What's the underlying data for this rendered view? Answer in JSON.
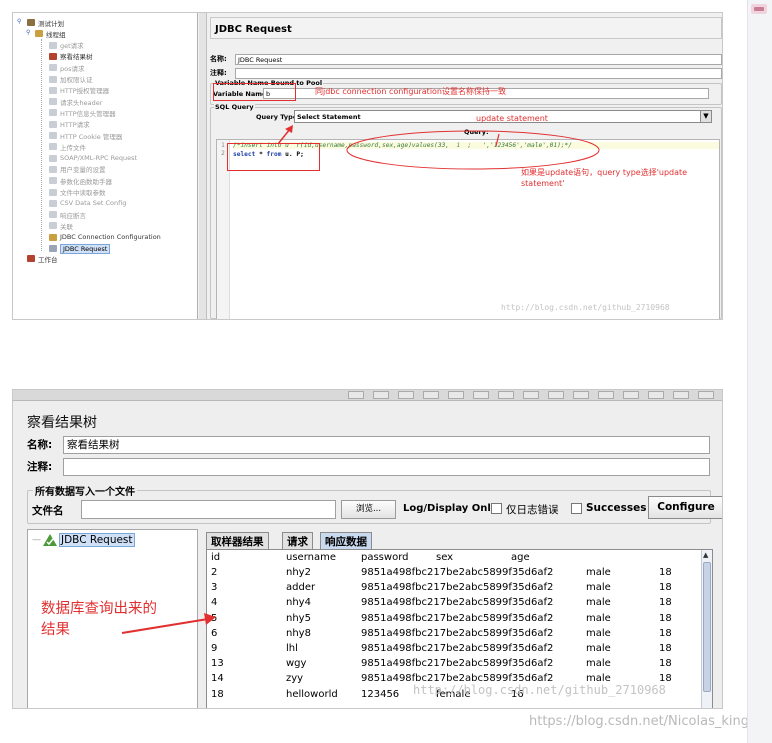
{
  "top": {
    "tree": {
      "items": [
        {
          "label": "测试计划",
          "level": 0,
          "dim": false
        },
        {
          "label": "线程组",
          "level": 1,
          "dim": false
        },
        {
          "label": "get请求",
          "level": 2,
          "dim": true
        },
        {
          "label": "察看结果树",
          "level": 2,
          "dim": false
        },
        {
          "label": "pos请求",
          "level": 2,
          "dim": true
        },
        {
          "label": "加权限认证",
          "level": 2,
          "dim": true
        },
        {
          "label": "HTTP授权管理器",
          "level": 2,
          "dim": true
        },
        {
          "label": "请求头header",
          "level": 2,
          "dim": true
        },
        {
          "label": "HTTP信息头管理器",
          "level": 2,
          "dim": true
        },
        {
          "label": "HTTP请求",
          "level": 2,
          "dim": true
        },
        {
          "label": "HTTP Cookie 管理器",
          "level": 2,
          "dim": true
        },
        {
          "label": "上传文件",
          "level": 2,
          "dim": true
        },
        {
          "label": "SOAP/XML-RPC Request",
          "level": 2,
          "dim": true
        },
        {
          "label": "用户变量的设置",
          "level": 2,
          "dim": true
        },
        {
          "label": "参数化函数助手器",
          "level": 2,
          "dim": true
        },
        {
          "label": "文件中读取参数",
          "level": 2,
          "dim": true
        },
        {
          "label": "CSV Data Set Config",
          "level": 2,
          "dim": true
        },
        {
          "label": "响应断言",
          "level": 2,
          "dim": true
        },
        {
          "label": "关联",
          "level": 2,
          "dim": true
        },
        {
          "label": "JDBC Connection Configuration",
          "level": 2,
          "dim": false
        },
        {
          "label": "JDBC Request",
          "level": 2,
          "dim": false,
          "selected": true
        },
        {
          "label": "工作台",
          "level": 0,
          "dim": false
        }
      ]
    },
    "jdbc": {
      "title": "JDBC Request",
      "name_label": "名称:",
      "name_value": "JDBC Request",
      "comment_label": "注释:",
      "comment_value": "",
      "varbound_title": "Variable Name Bound to Pool",
      "varname_label": "Variable Name:",
      "varname_value": "b",
      "sql_title": "SQL Query",
      "querytype_label": "Query Type:",
      "querytype_value": "Select Statement",
      "query_label": "Query:",
      "line1_no": "1",
      "line2_no": "2",
      "line1": "/*insert into u  r(id,username,password,sex,age)values(33,  i  ;   ','123456','male',01);*/",
      "line2_kw1": "select",
      "line2_mid": " * ",
      "line2_kw2": "from",
      "line2_end": " u. P;"
    },
    "annotations": {
      "same_name": "同jdbc connection configuration设置名称保持一致",
      "update": "update statement",
      "update_note_1": "如果是update语句，query type选择'update",
      "update_note_2": "statement'"
    },
    "watermark": "http://blog.csdn.net/github_2710968"
  },
  "bottom": {
    "title": "察看结果树",
    "name_label": "名称:",
    "name_value": "察看结果树",
    "comment_label": "注释:",
    "comment_value": "",
    "writefile_title": "所有数据写入一个文件",
    "file_label": "文件名",
    "file_value": "",
    "browse_label": "浏览...",
    "logonly_label": "Log/Display Only:",
    "errors_label": "仅日志错误",
    "success_label": "Successes",
    "configure_label": "Configure",
    "tree_node": "JDBC Request",
    "tabs": [
      "取样器结果",
      "请求",
      "响应数据"
    ],
    "columns": [
      "id",
      "username",
      "password",
      "sex",
      "age"
    ],
    "rows": [
      [
        "2",
        "nhy2",
        "9851a498fbc217be2abc5899f35d6af2",
        "male",
        "18"
      ],
      [
        "3",
        "adder",
        "9851a498fbc217be2abc5899f35d6af2",
        "male",
        "18"
      ],
      [
        "4",
        "nhy4",
        "9851a498fbc217be2abc5899f35d6af2",
        "male",
        "18"
      ],
      [
        "5",
        "nhy5",
        "9851a498fbc217be2abc5899f35d6af2",
        "male",
        "18"
      ],
      [
        "6",
        "nhy8",
        "9851a498fbc217be2abc5899f35d6af2",
        "male",
        "18"
      ],
      [
        "9",
        "lhl",
        "9851a498fbc217be2abc5899f35d6af2",
        "male",
        "18"
      ],
      [
        "13",
        "wgy",
        "9851a498fbc217be2abc5899f35d6af2",
        "male",
        "18"
      ],
      [
        "14",
        "zyy",
        "9851a498fbc217be2abc5899f35d6af2",
        "male",
        "18"
      ],
      [
        "18",
        "helloworld",
        "123456",
        "female",
        "16"
      ]
    ],
    "annotation_1": "数据库查询出来的",
    "annotation_2": "结果",
    "watermark": "http://blog.csdn.net/github_2710968"
  },
  "footer_watermark": "https://blog.csdn.net/Nicolas_king"
}
